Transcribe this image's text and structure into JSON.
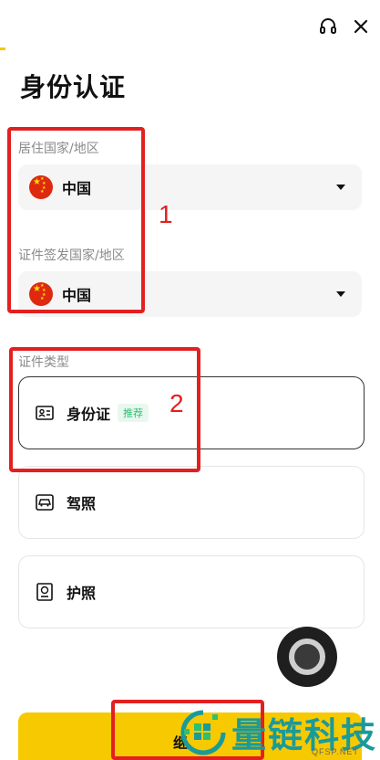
{
  "header": {
    "title": "身份认证",
    "icons": [
      "headset-icon",
      "close-icon"
    ]
  },
  "residence": {
    "label": "居住国家/地区",
    "value": "中国"
  },
  "issuing": {
    "label": "证件签发国家/地区",
    "value": "中国"
  },
  "doc_types": {
    "label": "证件类型",
    "options": [
      {
        "label": "身份证",
        "badge": "推荐",
        "icon": "id-card-icon",
        "selected": true
      },
      {
        "label": "驾照",
        "icon": "car-icon",
        "selected": false
      },
      {
        "label": "护照",
        "icon": "passport-icon",
        "selected": false
      }
    ]
  },
  "annotations": {
    "one": "1",
    "two": "2"
  },
  "bottom": {
    "button_label": "继"
  },
  "watermark": {
    "text": "量链科技",
    "sub": "QFSP.NET"
  },
  "colors": {
    "accent": "#f7c900",
    "annotation": "#e22020",
    "badge_green": "#2fbf71",
    "flag_red": "#de2910",
    "watermark": "#1a9a9a"
  }
}
